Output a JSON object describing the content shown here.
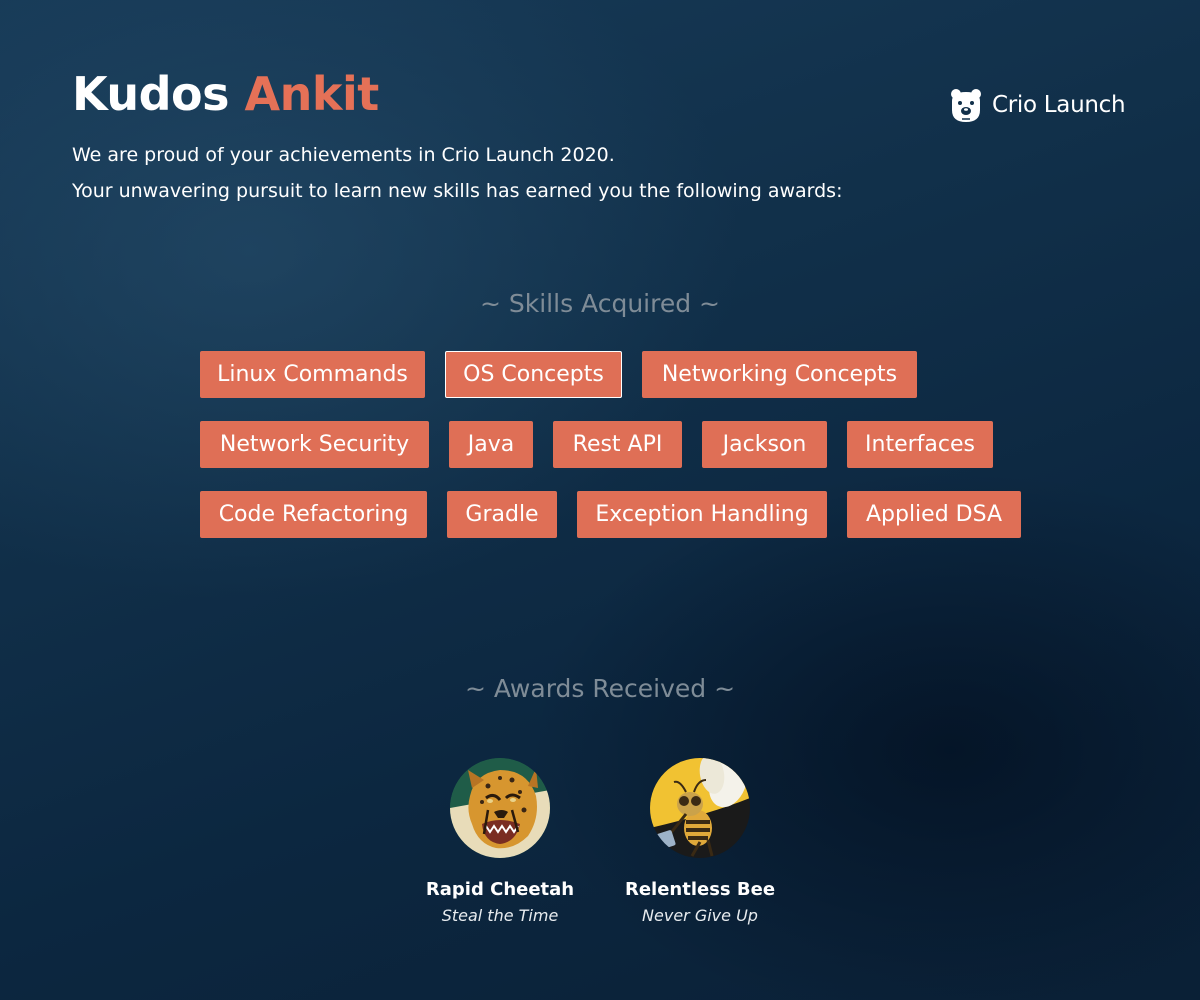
{
  "header": {
    "greeting": "Kudos",
    "name": "Ankit",
    "brand": "Crio Launch",
    "brand_icon": "bear-logo-icon"
  },
  "intro": {
    "line1": "We are proud of your achievements in Crio Launch 2020.",
    "line2": "Your unwavering pursuit to learn new skills has earned you the following awards:"
  },
  "skills": {
    "heading": "~ Skills Acquired ~",
    "items": [
      "Linux Commands",
      "OS Concepts",
      "Networking Concepts",
      "Network Security",
      "Java",
      "Rest API",
      "Jackson",
      "Interfaces",
      "Code Refactoring",
      "Gradle",
      "Exception Handling",
      "Applied DSA"
    ]
  },
  "awards": {
    "heading": "~ Awards Received ~",
    "items": [
      {
        "name": "Rapid Cheetah",
        "motto": "Steal the Time",
        "icon": "cheetah-badge-icon"
      },
      {
        "name": "Relentless Bee",
        "motto": "Never Give Up",
        "icon": "bee-badge-icon"
      }
    ]
  },
  "colors": {
    "accent": "#df6f56",
    "name_highlight": "#e57157",
    "background": "#11304a",
    "heading_muted": "#7f8c97"
  }
}
